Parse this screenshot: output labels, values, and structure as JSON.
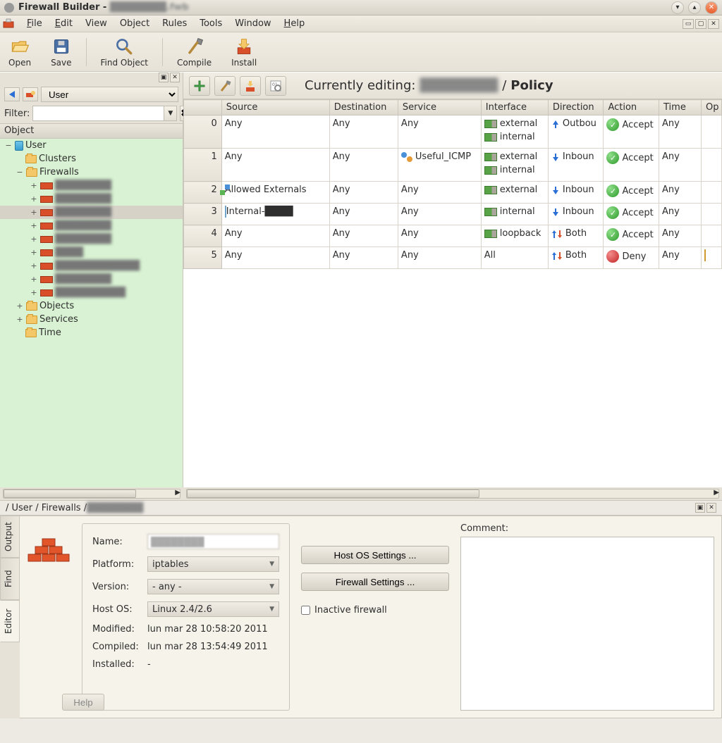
{
  "window": {
    "title": "Firewall Builder - "
  },
  "menubar": [
    "File",
    "Edit",
    "View",
    "Object",
    "Rules",
    "Tools",
    "Window",
    "Help"
  ],
  "menubar_underline_idx": [
    0,
    0,
    -1,
    -1,
    -1,
    -1,
    -1,
    0
  ],
  "toolbar": {
    "open": "Open",
    "save": "Save",
    "find": "Find Object",
    "compile": "Compile",
    "install": "Install"
  },
  "left": {
    "user_selector": "User",
    "filter_label": "Filter:",
    "clear": "✖",
    "tree_header": "Object",
    "tree": {
      "root": "User",
      "clusters": "Clusters",
      "firewalls": "Firewalls",
      "objects": "Objects",
      "services": "Services",
      "time": "Time",
      "fw_items": [
        "████████",
        "████████",
        "████████",
        "████████",
        "████████",
        "████",
        "████████████",
        "████████",
        "██████████"
      ],
      "fw_selected_index": 2
    }
  },
  "right": {
    "editing_prefix": "Currently editing:",
    "editing_policy": "Policy",
    "headers": [
      "",
      "Source",
      "Destination",
      "Service",
      "Interface",
      "Direction",
      "Action",
      "Time",
      "Op"
    ],
    "rows": [
      {
        "n": "0",
        "src": "Any",
        "dst": "Any",
        "svc": "Any",
        "iface": [
          "external",
          "internal"
        ],
        "dir": "Outbound",
        "dir_type": "up",
        "act": "Accept",
        "time": "Any"
      },
      {
        "n": "1",
        "src": "Any",
        "dst": "Any",
        "svc": "Useful_ICMP",
        "svc_icon": "svc",
        "iface": [
          "external",
          "internal"
        ],
        "dir": "Inbound",
        "dir_type": "down",
        "act": "Accept",
        "time": "Any"
      },
      {
        "n": "2",
        "src": "Allowed Externals",
        "src_icon": "grp",
        "dst": "Any",
        "svc": "Any",
        "iface": [
          "external"
        ],
        "dir": "Inbound",
        "dir_type": "down",
        "act": "Accept",
        "time": "Any"
      },
      {
        "n": "3",
        "src": "Internal-████",
        "src_icon": "host",
        "dst": "Any",
        "svc": "Any",
        "iface": [
          "internal"
        ],
        "dir": "Inbound",
        "dir_type": "down",
        "act": "Accept",
        "time": "Any"
      },
      {
        "n": "4",
        "src": "Any",
        "dst": "Any",
        "svc": "Any",
        "iface": [
          "loopback"
        ],
        "dir": "Both",
        "dir_type": "both",
        "act": "Accept",
        "time": "Any"
      },
      {
        "n": "5",
        "src": "Any",
        "dst": "Any",
        "svc": "Any",
        "iface_plain": "All",
        "dir": "Both",
        "dir_type": "both",
        "act": "Deny",
        "time": "Any",
        "opt": true
      }
    ]
  },
  "breadcrumb": {
    "path": "/ User / Firewalls / ",
    "tail": "████████"
  },
  "editor": {
    "tabs": [
      "Output",
      "Find",
      "Editor"
    ],
    "form": {
      "name_label": "Name:",
      "name_value": "████████",
      "platform_label": "Platform:",
      "platform_value": "iptables",
      "version_label": "Version:",
      "version_value": "- any -",
      "hostos_label": "Host OS:",
      "hostos_value": "Linux 2.4/2.6",
      "modified_label": "Modified:",
      "modified_value": "lun mar 28 10:58:20 2011",
      "compiled_label": "Compiled:",
      "compiled_value": "lun mar 28 13:54:49 2011",
      "installed_label": "Installed:",
      "installed_value": "-"
    },
    "host_os_btn": "Host OS Settings ...",
    "fw_settings_btn": "Firewall Settings ...",
    "inactive_label": "Inactive firewall",
    "comment_label": "Comment:",
    "help_btn": "Help"
  }
}
